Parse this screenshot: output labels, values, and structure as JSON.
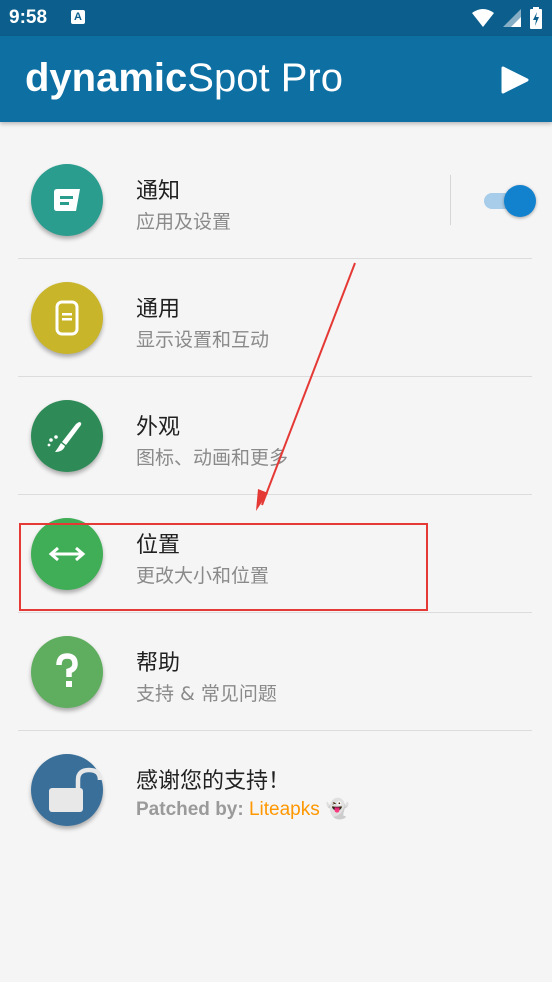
{
  "status_bar": {
    "time": "9:58",
    "badge": "A"
  },
  "app_bar": {
    "title_bold": "dynamic",
    "title_rest": "Spot Pro",
    "play_icon": "play-icon"
  },
  "menu": [
    {
      "title": "通知",
      "subtitle": "应用及设置",
      "color": "#2a9d8f",
      "icon": "notification-icon",
      "toggle_on": true
    },
    {
      "title": "通用",
      "subtitle": "显示设置和互动",
      "color": "#c8b52a",
      "icon": "phone-icon"
    },
    {
      "title": "外观",
      "subtitle": "图标、动画和更多",
      "color": "#2e8b57",
      "icon": "brush-icon"
    },
    {
      "title": "位置",
      "subtitle": "更改大小和位置",
      "color": "#3fae56",
      "icon": "resize-arrows-icon"
    },
    {
      "title": "帮助",
      "subtitle": "支持 & 常见问题",
      "color": "#5fad5f",
      "icon": "question-icon"
    },
    {
      "title": "感谢您的支持！",
      "subtitle_prefix": "Patched by: ",
      "subtitle_brand": "Liteapks",
      "subtitle_suffix": " 👻",
      "color": "#3a6f9a",
      "icon": "unlock-icon"
    }
  ],
  "colors": {
    "app_bar": "#0e6fa3",
    "status_bar": "#0c5f8c",
    "annotation": "#e53935"
  }
}
